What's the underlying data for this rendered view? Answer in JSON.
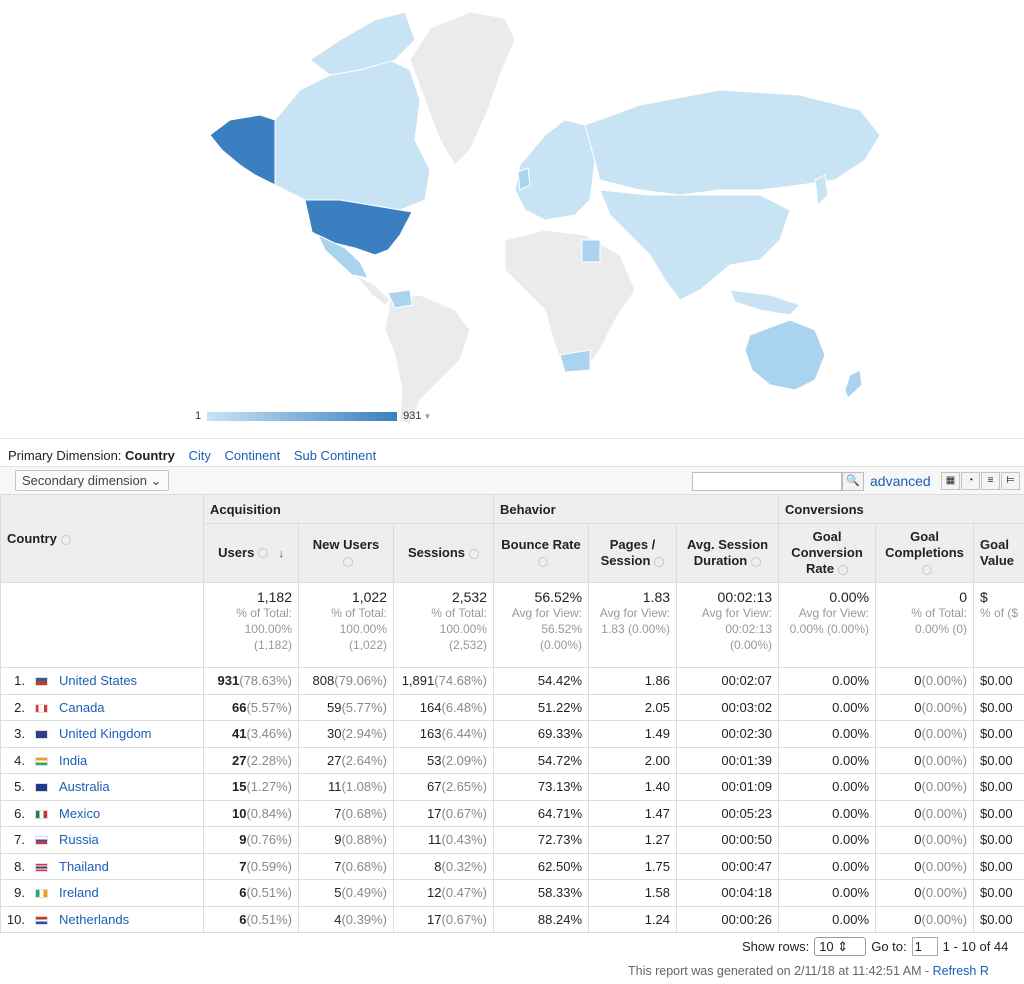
{
  "legend": {
    "min": "1",
    "max": "931"
  },
  "dimension": {
    "label": "Primary Dimension:",
    "active": "Country",
    "links": [
      "City",
      "Continent",
      "Sub Continent"
    ]
  },
  "toolbar": {
    "secondary": "Secondary dimension",
    "advanced": "advanced"
  },
  "table": {
    "groups": {
      "acq": "Acquisition",
      "beh": "Behavior",
      "conv": "Conversions"
    },
    "headers": {
      "country": "Country",
      "users": "Users",
      "new_users": "New Users",
      "sessions": "Sessions",
      "bounce": "Bounce Rate",
      "pages": "Pages / Session",
      "duration": "Avg. Session Duration",
      "gcr": "Goal Conversion Rate",
      "gc": "Goal Completions",
      "gv": "Goal Value"
    },
    "totals": {
      "users": "1,182",
      "users_sub": "% of Total: 100.00% (1,182)",
      "new_users": "1,022",
      "new_users_sub": "% of Total: 100.00% (1,022)",
      "sessions": "2,532",
      "sessions_sub": "% of Total: 100.00% (2,532)",
      "bounce": "56.52%",
      "bounce_sub": "Avg for View: 56.52% (0.00%)",
      "pages": "1.83",
      "pages_sub": "Avg for View: 1.83 (0.00%)",
      "duration": "00:02:13",
      "duration_sub": "Avg for View: 00:02:13 (0.00%)",
      "gcr": "0.00%",
      "gcr_sub": "Avg for View: 0.00% (0.00%)",
      "gc": "0",
      "gc_sub": "% of Total: 0.00% (0)",
      "gv": "$",
      "gv_sub": "% of ($"
    },
    "rows": [
      {
        "idx": "1.",
        "country": "United States",
        "users": "931",
        "users_p": "(78.63%)",
        "new": "808",
        "new_p": "(79.06%)",
        "sess": "1,891",
        "sess_p": "(74.68%)",
        "bounce": "54.42%",
        "pages": "1.86",
        "dur": "00:02:07",
        "gcr": "0.00%",
        "gc": "0",
        "gc_p": "(0.00%)",
        "gv": "$0.00"
      },
      {
        "idx": "2.",
        "country": "Canada",
        "users": "66",
        "users_p": "(5.57%)",
        "new": "59",
        "new_p": "(5.77%)",
        "sess": "164",
        "sess_p": "(6.48%)",
        "bounce": "51.22%",
        "pages": "2.05",
        "dur": "00:03:02",
        "gcr": "0.00%",
        "gc": "0",
        "gc_p": "(0.00%)",
        "gv": "$0.00"
      },
      {
        "idx": "3.",
        "country": "United Kingdom",
        "users": "41",
        "users_p": "(3.46%)",
        "new": "30",
        "new_p": "(2.94%)",
        "sess": "163",
        "sess_p": "(6.44%)",
        "bounce": "69.33%",
        "pages": "1.49",
        "dur": "00:02:30",
        "gcr": "0.00%",
        "gc": "0",
        "gc_p": "(0.00%)",
        "gv": "$0.00"
      },
      {
        "idx": "4.",
        "country": "India",
        "users": "27",
        "users_p": "(2.28%)",
        "new": "27",
        "new_p": "(2.64%)",
        "sess": "53",
        "sess_p": "(2.09%)",
        "bounce": "54.72%",
        "pages": "2.00",
        "dur": "00:01:39",
        "gcr": "0.00%",
        "gc": "0",
        "gc_p": "(0.00%)",
        "gv": "$0.00"
      },
      {
        "idx": "5.",
        "country": "Australia",
        "users": "15",
        "users_p": "(1.27%)",
        "new": "11",
        "new_p": "(1.08%)",
        "sess": "67",
        "sess_p": "(2.65%)",
        "bounce": "73.13%",
        "pages": "1.40",
        "dur": "00:01:09",
        "gcr": "0.00%",
        "gc": "0",
        "gc_p": "(0.00%)",
        "gv": "$0.00"
      },
      {
        "idx": "6.",
        "country": "Mexico",
        "users": "10",
        "users_p": "(0.84%)",
        "new": "7",
        "new_p": "(0.68%)",
        "sess": "17",
        "sess_p": "(0.67%)",
        "bounce": "64.71%",
        "pages": "1.47",
        "dur": "00:05:23",
        "gcr": "0.00%",
        "gc": "0",
        "gc_p": "(0.00%)",
        "gv": "$0.00"
      },
      {
        "idx": "7.",
        "country": "Russia",
        "users": "9",
        "users_p": "(0.76%)",
        "new": "9",
        "new_p": "(0.88%)",
        "sess": "11",
        "sess_p": "(0.43%)",
        "bounce": "72.73%",
        "pages": "1.27",
        "dur": "00:00:50",
        "gcr": "0.00%",
        "gc": "0",
        "gc_p": "(0.00%)",
        "gv": "$0.00"
      },
      {
        "idx": "8.",
        "country": "Thailand",
        "users": "7",
        "users_p": "(0.59%)",
        "new": "7",
        "new_p": "(0.68%)",
        "sess": "8",
        "sess_p": "(0.32%)",
        "bounce": "62.50%",
        "pages": "1.75",
        "dur": "00:00:47",
        "gcr": "0.00%",
        "gc": "0",
        "gc_p": "(0.00%)",
        "gv": "$0.00"
      },
      {
        "idx": "9.",
        "country": "Ireland",
        "users": "6",
        "users_p": "(0.51%)",
        "new": "5",
        "new_p": "(0.49%)",
        "sess": "12",
        "sess_p": "(0.47%)",
        "bounce": "58.33%",
        "pages": "1.58",
        "dur": "00:04:18",
        "gcr": "0.00%",
        "gc": "0",
        "gc_p": "(0.00%)",
        "gv": "$0.00"
      },
      {
        "idx": "10.",
        "country": "Netherlands",
        "users": "6",
        "users_p": "(0.51%)",
        "new": "4",
        "new_p": "(0.39%)",
        "sess": "17",
        "sess_p": "(0.67%)",
        "bounce": "88.24%",
        "pages": "1.24",
        "dur": "00:00:26",
        "gcr": "0.00%",
        "gc": "0",
        "gc_p": "(0.00%)",
        "gv": "$0.00"
      }
    ]
  },
  "footer": {
    "show_rows": "Show rows:",
    "rows_value": "10",
    "goto": "Go to:",
    "goto_value": "1",
    "range": "1 - 10 of 44",
    "generated": "This report was generated on 2/11/18 at 11:42:51 AM - ",
    "refresh": "Refresh R"
  },
  "colors": {
    "high": "#3a7fbf",
    "mid": "#a9d3ef",
    "low": "#c8e3f4",
    "none": "#ebebeb",
    "link": "#1a5fb4"
  }
}
